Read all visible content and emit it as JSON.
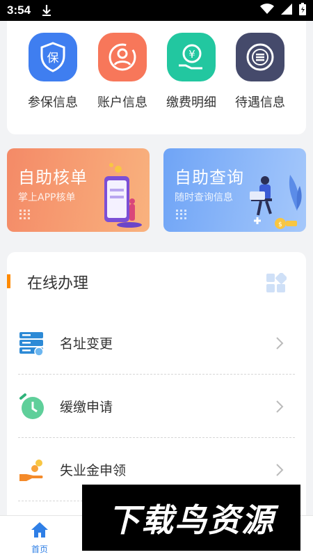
{
  "status_bar": {
    "time": "3:54"
  },
  "quick_menu": [
    {
      "label": "参保信息",
      "icon": "shield-icon",
      "color": "#3f7ef0"
    },
    {
      "label": "账户信息",
      "icon": "account-icon",
      "color": "#f7775a"
    },
    {
      "label": "缴费明细",
      "icon": "payment-icon",
      "color": "#22c7a0"
    },
    {
      "label": "待遇信息",
      "icon": "benefit-icon",
      "color": "#454a6b"
    }
  ],
  "banners": [
    {
      "title": "自助核单",
      "subtitle": "掌上APP核单"
    },
    {
      "title": "自助查询",
      "subtitle": "随时查询信息"
    }
  ],
  "online": {
    "title": "在线办理",
    "items": [
      {
        "label": "名址变更",
        "icon": "server-icon"
      },
      {
        "label": "缓缴申请",
        "icon": "clock-icon"
      },
      {
        "label": "失业金申领",
        "icon": "hand-coin-icon"
      }
    ]
  },
  "tabbar": {
    "home_label": "首页"
  },
  "watermark": {
    "text": "下载鸟资源"
  }
}
